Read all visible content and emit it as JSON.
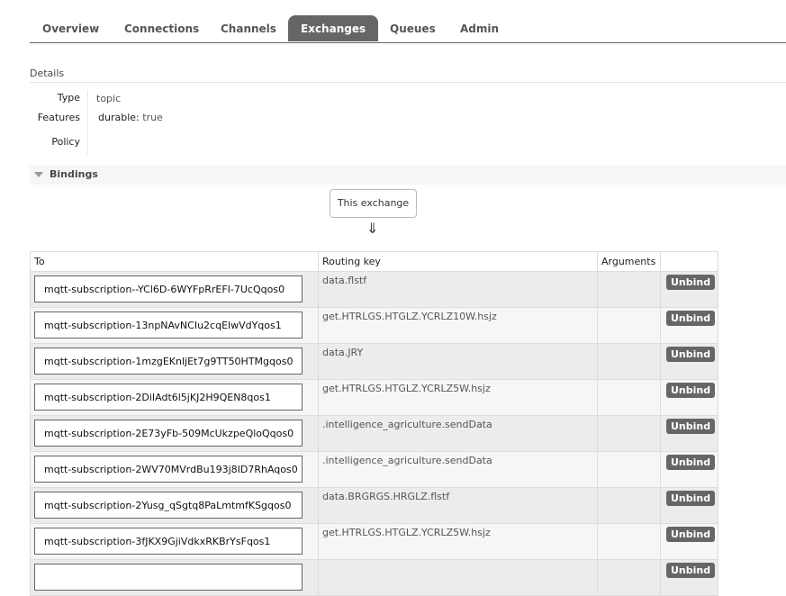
{
  "tabs": [
    {
      "label": "Overview",
      "active": false
    },
    {
      "label": "Connections",
      "active": false
    },
    {
      "label": "Channels",
      "active": false
    },
    {
      "label": "Exchanges",
      "active": true
    },
    {
      "label": "Queues",
      "active": false
    },
    {
      "label": "Admin",
      "active": false
    }
  ],
  "details": {
    "title": "Details",
    "type_label": "Type",
    "type_value": "topic",
    "features_label": "Features",
    "durable_key": "durable:",
    "durable_value": "true",
    "policy_label": "Policy",
    "policy_value": ""
  },
  "bindings": {
    "title": "Bindings",
    "this_exchange": "This exchange",
    "arrow": "⇓",
    "headers": {
      "to": "To",
      "routing_key": "Routing key",
      "arguments": "Arguments",
      "action": ""
    },
    "unbind_label": "Unbind",
    "rows": [
      {
        "to": "mqtt-subscription--YCl6D-6WYFpRrEFI-7UcQqos0",
        "routing_key": "data.flstf",
        "arguments": ""
      },
      {
        "to": "mqtt-subscription-13npNAvNCIu2cqElwVdYqos1",
        "routing_key": "get.HTRLGS.HTGLZ.YCRLZ10W.hsjz",
        "arguments": ""
      },
      {
        "to": "mqtt-subscription-1mzgEKnljEt7g9TT50HTMgqos0",
        "routing_key": "data.JRY",
        "arguments": ""
      },
      {
        "to": "mqtt-subscription-2DiIAdt6l5jKJ2H9QEN8qos1",
        "routing_key": "get.HTRLGS.HTGLZ.YCRLZ5W.hsjz",
        "arguments": ""
      },
      {
        "to": "mqtt-subscription-2E73yFb-509McUkzpeQloQqos0",
        "routing_key": ".intelligence_agriculture.sendData",
        "arguments": ""
      },
      {
        "to": "mqtt-subscription-2WV70MVrdBu193j8ID7RhAqos0",
        "routing_key": ".intelligence_agriculture.sendData",
        "arguments": ""
      },
      {
        "to": "mqtt-subscription-2Yusg_qSgtq8PaLmtmfKSgqos0",
        "routing_key": "data.BRGRGS.HRGLZ.flstf",
        "arguments": ""
      },
      {
        "to": "mqtt-subscription-3fJKX9GjiVdkxRKBrYsFqos1",
        "routing_key": "get.HTRLGS.HTGLZ.YCRLZ5W.hsjz",
        "arguments": ""
      },
      {
        "to": "",
        "routing_key": "",
        "arguments": ""
      }
    ]
  }
}
